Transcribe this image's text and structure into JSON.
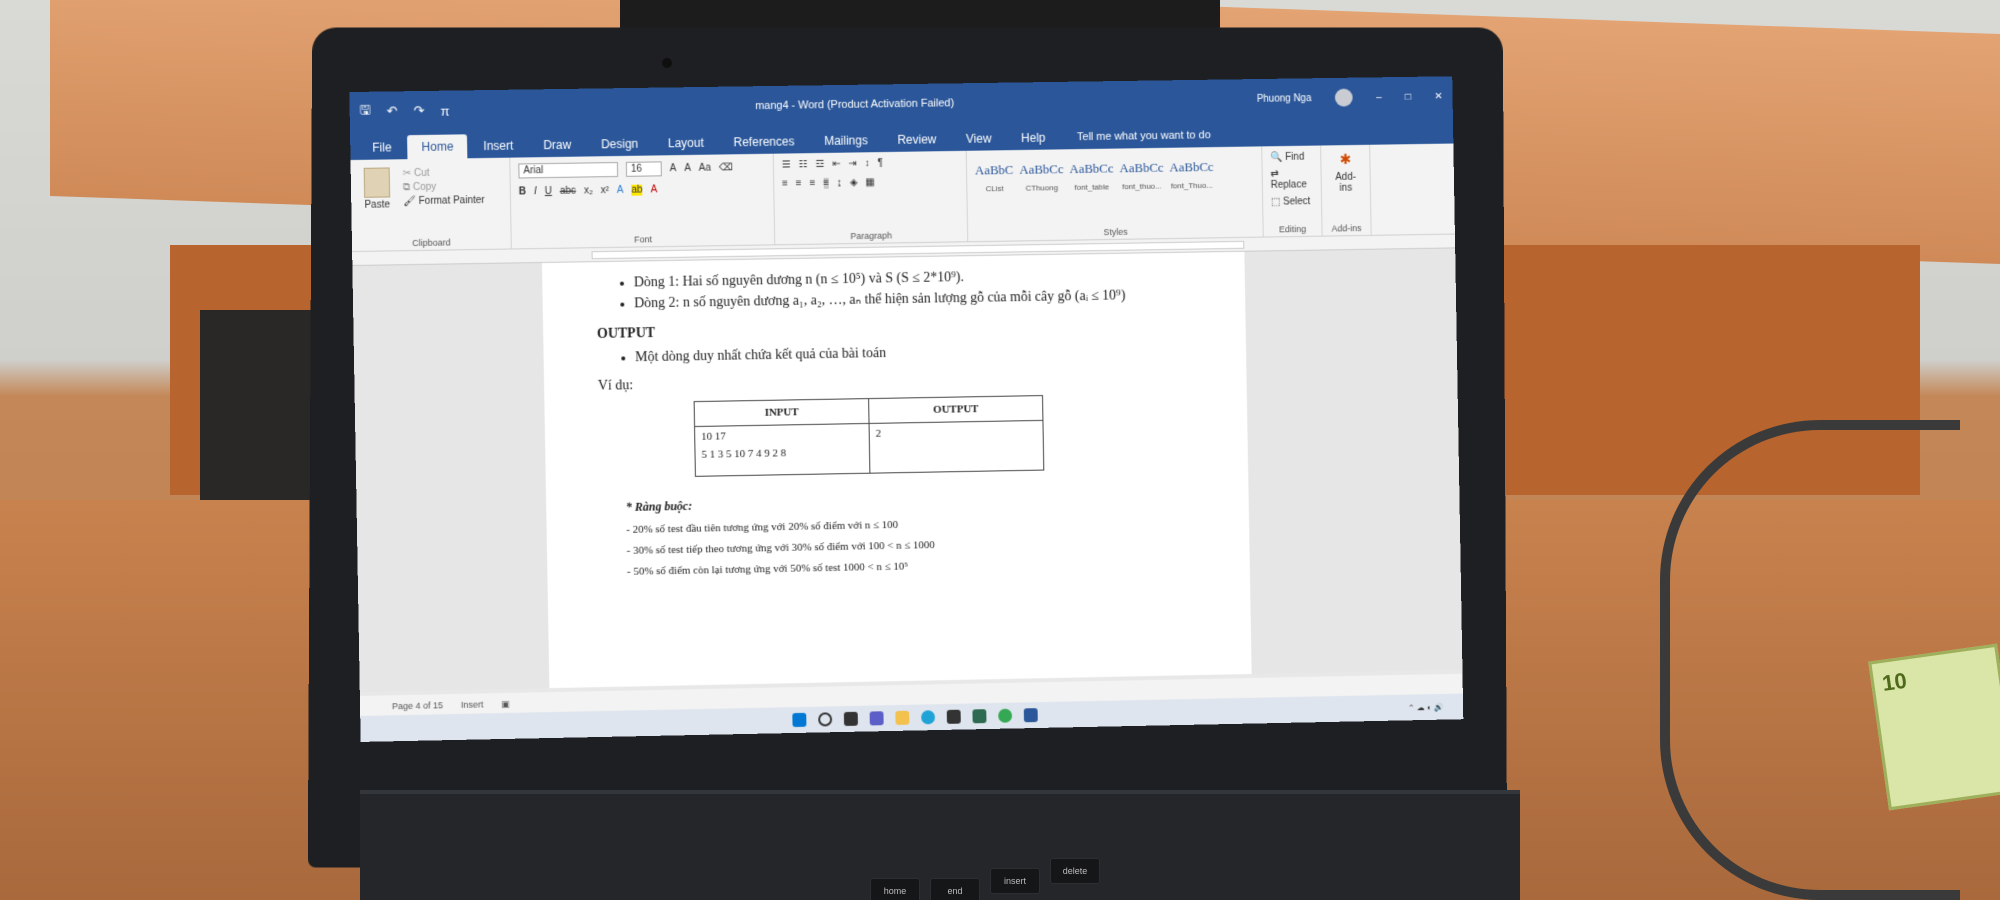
{
  "window": {
    "title": "mang4 - Word (Product Activation Failed)",
    "user": "Phuong Nga"
  },
  "tabs": [
    "File",
    "Home",
    "Insert",
    "Draw",
    "Design",
    "Layout",
    "References",
    "Mailings",
    "Review",
    "View",
    "Help"
  ],
  "active_tab": "Home",
  "tell_me": "Tell me what you want to do",
  "ribbon": {
    "clipboard": {
      "paste": "Paste",
      "cut": "Cut",
      "copy": "Copy",
      "format_painter": "Format Painter",
      "label": "Clipboard"
    },
    "font": {
      "name": "Arial",
      "size": "16",
      "label": "Font"
    },
    "paragraph": {
      "label": "Paragraph"
    },
    "styles": {
      "label": "Styles",
      "items": [
        {
          "preview": "AaBbC",
          "name": "CList"
        },
        {
          "preview": "AaBbCc",
          "name": "CThuong"
        },
        {
          "preview": "AaBbCc",
          "name": "font_table"
        },
        {
          "preview": "AaBbCc",
          "name": "font_thuo..."
        },
        {
          "preview": "AaBbCc",
          "name": "font_Thuo..."
        }
      ]
    },
    "editing": {
      "find": "Find",
      "replace": "Replace",
      "select": "Select",
      "label": "Editing"
    },
    "addins": {
      "button": "Add-ins",
      "label": "Add-ins"
    }
  },
  "document": {
    "input_lines": [
      "Dòng 1: Hai số nguyên dương n (n ≤ 10⁵) và S (S ≤ 2*10⁹).",
      "Dòng 2: n số nguyên dương a₁, a₂, …, aₙ thể hiện sản lượng gỗ của mỗi cây gỗ (aᵢ ≤ 10⁹)"
    ],
    "output_heading": "OUTPUT",
    "output_lines": [
      "Một dòng duy nhất chứa kết quả của bài toán"
    ],
    "example_label": "Ví dụ:",
    "example_table": {
      "headers": [
        "INPUT",
        "OUTPUT"
      ],
      "input": [
        "10 17",
        "5 1 3 5 10 7 4 9 2 8"
      ],
      "output": "2"
    },
    "constraints_title": "* Ràng buộc:",
    "constraints": [
      "- 20% số test đầu tiên tương ứng với 20% số điểm với n ≤ 100",
      "- 30% số test tiếp theo tương ứng với 30% số điểm với 100 < n ≤ 1000",
      "- 50% số điểm còn lại tương ứng với 50% số test 1000 < n ≤ 10⁵"
    ]
  },
  "status": {
    "page": "Page 4 of 15",
    "mode": "Insert"
  },
  "keyboard": [
    "home",
    "end",
    "insert",
    "delete"
  ],
  "package_label": "10"
}
